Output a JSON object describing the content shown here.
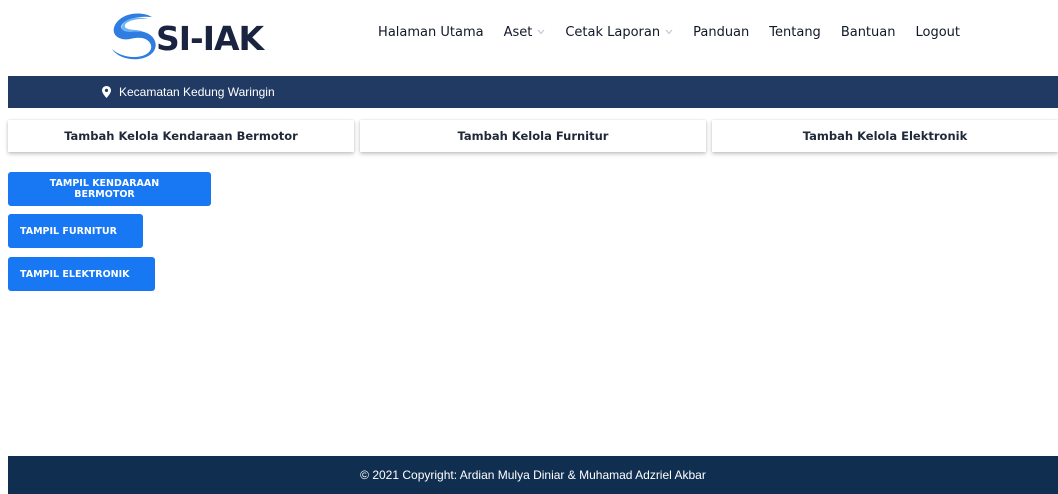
{
  "brand": {
    "logo_text": "SI-IAK",
    "colors": {
      "blue": "#2f7de1",
      "light_blue": "#6fb4f2",
      "dark": "#1a2340"
    }
  },
  "nav": {
    "items": [
      {
        "label": "Halaman Utama",
        "dropdown": false
      },
      {
        "label": "Aset",
        "dropdown": true
      },
      {
        "label": "Cetak Laporan",
        "dropdown": true
      },
      {
        "label": "Panduan",
        "dropdown": false
      },
      {
        "label": "Tentang",
        "dropdown": false
      },
      {
        "label": "Bantuan",
        "dropdown": false
      },
      {
        "label": "Logout",
        "dropdown": false
      }
    ]
  },
  "topbar": {
    "icon": "map-pin-icon",
    "location": "Kecamatan Kedung Waringin",
    "bg_color": "#203a63"
  },
  "tabs": [
    {
      "label": "Tambah Kelola Kendaraan Bermotor"
    },
    {
      "label": "Tambah Kelola Furnitur"
    },
    {
      "label": "Tambah Kelola Elektronik"
    }
  ],
  "buttons": {
    "color": "#1877f2",
    "items": [
      {
        "label": "TAMPIL KENDARAAN BERMOTOR"
      },
      {
        "label": "TAMPIL FURNITUR"
      },
      {
        "label": "TAMPIL ELEKTRONIK"
      }
    ]
  },
  "footer": {
    "copyright": "© 2021 Copyright: Ardian Mulya Diniar & Muhamad Adzriel Akbar",
    "bg_color": "#0f2e50"
  }
}
